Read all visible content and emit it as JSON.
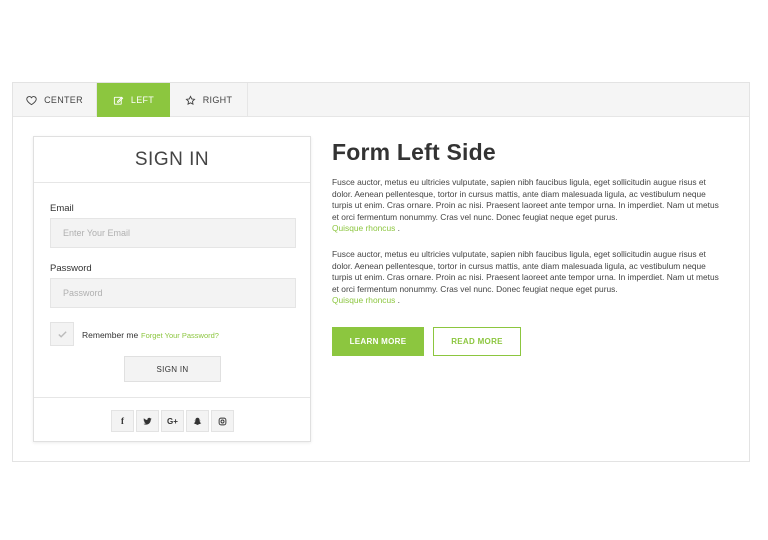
{
  "tabs": [
    {
      "label": "CENTER",
      "icon": "heart-icon"
    },
    {
      "label": "LEFT",
      "icon": "edit-icon"
    },
    {
      "label": "RIGHT",
      "icon": "star-icon"
    }
  ],
  "active_tab": "LEFT",
  "colors": {
    "accent": "#8cc63f"
  },
  "signin": {
    "title": "SIGN IN",
    "email_label": "Email",
    "email_placeholder": "Enter Your Email",
    "password_label": "Password",
    "password_placeholder": "Password",
    "remember_label": "Remember me",
    "forgot_label": "Forget Your Password?",
    "button_label": "SIGN IN",
    "social": [
      "facebook-icon",
      "twitter-icon",
      "google-plus-icon",
      "snapchat-icon",
      "instagram-icon"
    ]
  },
  "content": {
    "heading": "Form Left Side",
    "paragraphs": [
      {
        "text": "Fusce auctor, metus eu ultricies vulputate, sapien nibh faucibus ligula, eget sollicitudin augue risus et dolor. Aenean pellentesque, tortor in cursus mattis, ante diam malesuada ligula, ac vestibulum neque turpis ut enim. Cras ornare. Proin ac nisi. Praesent laoreet ante tempor urna. In imperdiet. Nam ut metus et orci fermentum nonummy. Cras vel nunc. Donec feugiat neque eget purus.",
        "link": "Quisque rhoncus"
      },
      {
        "text": "Fusce auctor, metus eu ultricies vulputate, sapien nibh faucibus ligula, eget sollicitudin augue risus et dolor. Aenean pellentesque, tortor in cursus mattis, ante diam malesuada ligula, ac vestibulum neque turpis ut enim. Cras ornare. Proin ac nisi. Praesent laoreet ante tempor urna. In imperdiet. Nam ut metus et orci fermentum nonummy. Cras vel nunc. Donec feugiat neque eget purus.",
        "link": "Quisque rhoncus"
      }
    ],
    "learn_more": "LEARN MORE",
    "read_more": "READ MORE"
  }
}
